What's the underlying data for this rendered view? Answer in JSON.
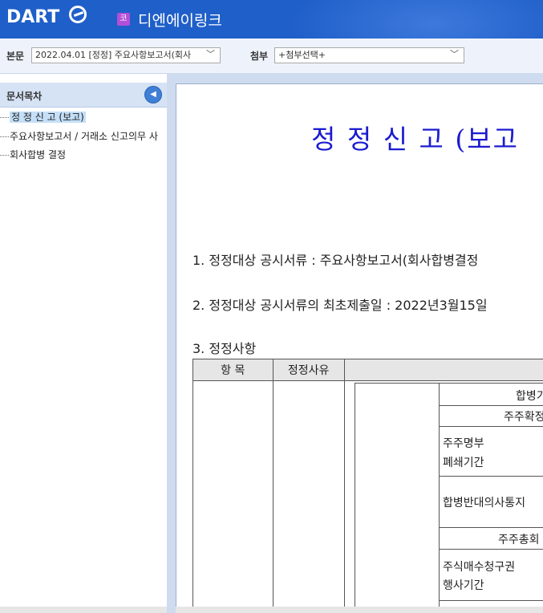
{
  "header": {
    "logo_text": "DART",
    "company_badge": "코",
    "company_name": "디엔에이링크",
    "brand_color": "#1f5fc9"
  },
  "toolbar": {
    "body_label": "본문",
    "body_select_value": "2022.04.01  [정정] 주요사항보고서(회사",
    "attach_label": "첨부",
    "attach_select_value": "+첨부선택+"
  },
  "sidebar": {
    "title": "문서목차",
    "items": [
      {
        "label": "정 정 신 고 (보고)",
        "selected": true
      },
      {
        "label": "주요사항보고서 / 거래소 신고의무 사"
      },
      {
        "label": "회사합병 결정"
      }
    ]
  },
  "document": {
    "title": "정 정 신 고 (보고",
    "item1": "1. 정정대상 공시서류 : 주요사항보고서(회사합병결정",
    "item2": "2. 정정대상 공시서류의 최초제출일 : 2022년3월15일",
    "item3": "3. 정정사항",
    "table": {
      "col1": "항 목",
      "col2": "정정사유"
    },
    "inner": {
      "h1": "합병기",
      "h2": "주주확정",
      "r1a": "주주명부",
      "r1b": "폐쇄기간",
      "r2": "합병반대의사통지 ",
      "h3": "주주총회",
      "r3a": "주식매수청구권",
      "r3b": "행사기간"
    }
  }
}
